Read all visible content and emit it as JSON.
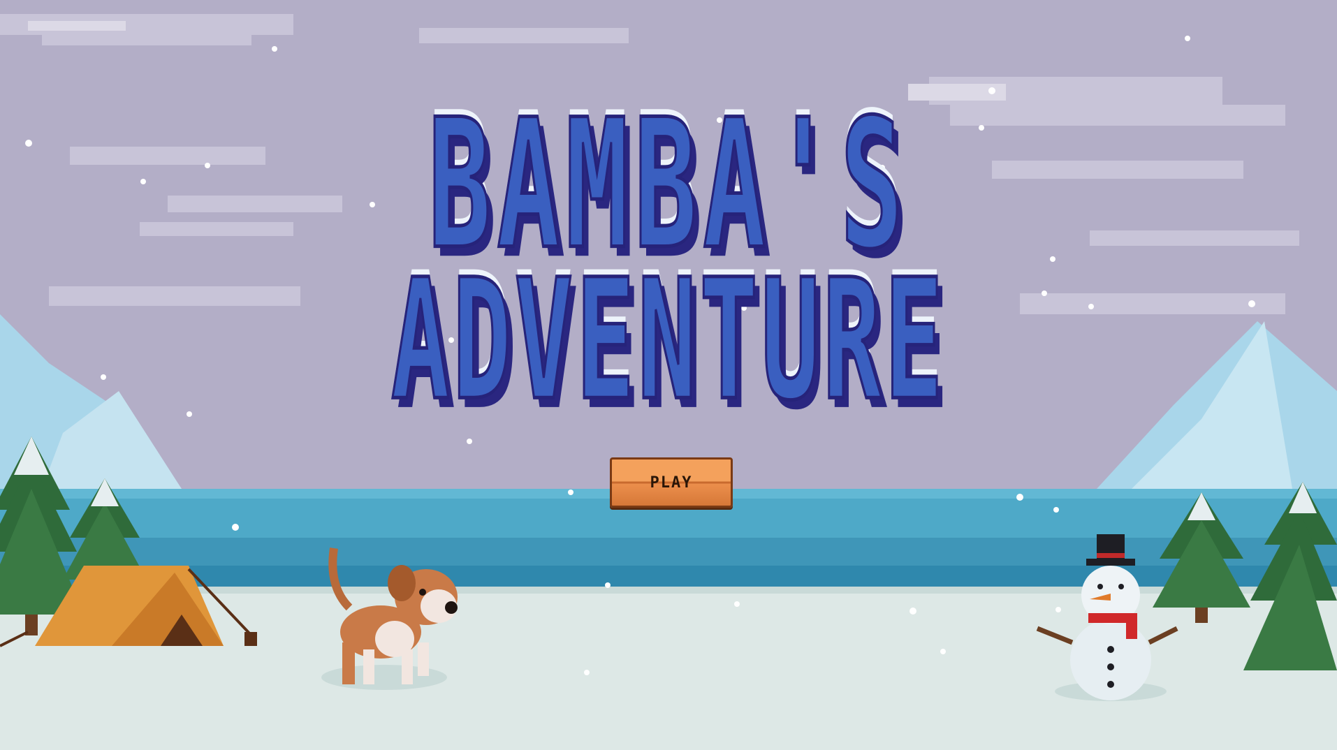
{
  "game": {
    "title_line_1": "BAMBA'S",
    "title_line_2": "ADVENTURE",
    "play_label": "PLAY"
  },
  "colors": {
    "sky": "#b3aec7",
    "cloud": "#c9c5d8",
    "sea": "#4ea9c8",
    "snow_ground": "#dde8e6",
    "title_blue": "#3a5fc0",
    "title_outline": "#26237a",
    "button_orange": "#f08f4c"
  }
}
